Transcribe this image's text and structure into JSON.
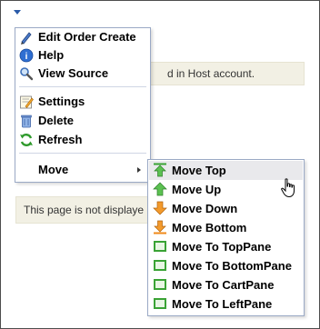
{
  "banners": {
    "top_text": "d in Host account.",
    "bottom_text": "This page is not displaye"
  },
  "menu": {
    "items": [
      {
        "label": "Edit Order Create",
        "icon": "pencil-icon"
      },
      {
        "label": "Help",
        "icon": "help-icon"
      },
      {
        "label": "View Source",
        "icon": "magnifier-icon"
      },
      {
        "label": "Settings",
        "icon": "settings-icon"
      },
      {
        "label": "Delete",
        "icon": "delete-icon"
      },
      {
        "label": "Refresh",
        "icon": "refresh-icon"
      },
      {
        "label": "Move",
        "icon": "submenu-arrow-icon"
      }
    ]
  },
  "submenu": {
    "items": [
      {
        "label": "Move Top",
        "icon": "move-top-icon"
      },
      {
        "label": "Move Up",
        "icon": "move-up-icon"
      },
      {
        "label": "Move Down",
        "icon": "move-down-icon"
      },
      {
        "label": "Move Bottom",
        "icon": "move-bottom-icon"
      },
      {
        "label": "Move To TopPane",
        "icon": "pane-icon"
      },
      {
        "label": "Move To BottomPane",
        "icon": "pane-icon"
      },
      {
        "label": "Move To CartPane",
        "icon": "pane-icon"
      },
      {
        "label": "Move To LeftPane",
        "icon": "pane-icon"
      }
    ],
    "hovered": "Move Top"
  },
  "colors": {
    "accent_blue": "#2a5aa8",
    "banner_bg": "#f2f0e4",
    "hover_bg": "#e9e9ec",
    "icon_green": "#3aa335",
    "icon_orange": "#f08a1a"
  }
}
